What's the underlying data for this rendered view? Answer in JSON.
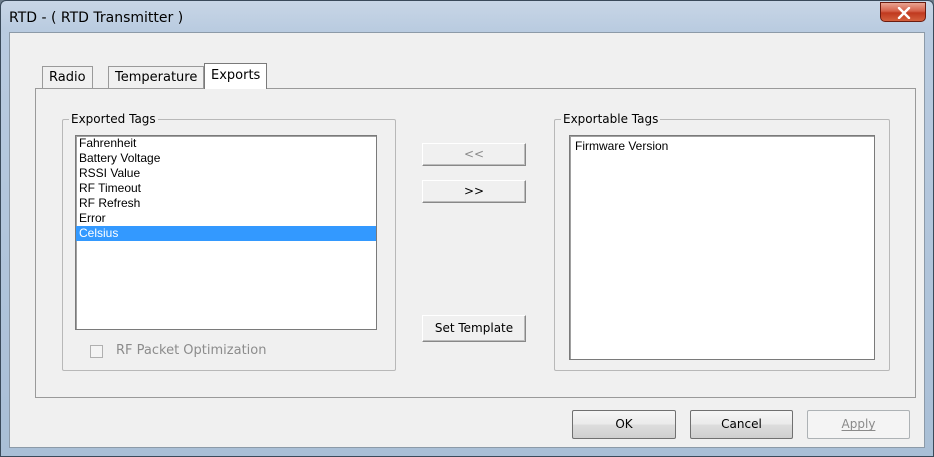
{
  "window": {
    "title": "RTD - ( RTD Transmitter )"
  },
  "tabs": [
    {
      "label": "Radio",
      "active": false
    },
    {
      "label": "Temperature",
      "active": false
    },
    {
      "label": "Exports",
      "active": true
    }
  ],
  "exported_tags": {
    "label": "Exported Tags",
    "items": [
      "Fahrenheit",
      "Battery Voltage",
      "RSSI Value",
      "RF Timeout",
      "RF Refresh",
      "Error",
      "Celsius"
    ],
    "selected": "Celsius"
  },
  "exportable_tags": {
    "label": "Exportable Tags",
    "items": [
      "Firmware Version"
    ]
  },
  "buttons": {
    "remove_label": "<<",
    "add_label": ">>",
    "set_template_label": "Set Template",
    "ok_label": "OK",
    "cancel_label": "Cancel",
    "apply_label": "Apply"
  },
  "options": {
    "rf_packet_optimization_label": "RF Packet Optimization",
    "rf_packet_optimization_checked": false,
    "rf_packet_optimization_enabled": false
  },
  "colors": {
    "selection": "#3399ff",
    "close_button": "#c0391f",
    "dialog_background": "#f0f0f0"
  },
  "icons": {
    "close": "close-x-icon"
  }
}
